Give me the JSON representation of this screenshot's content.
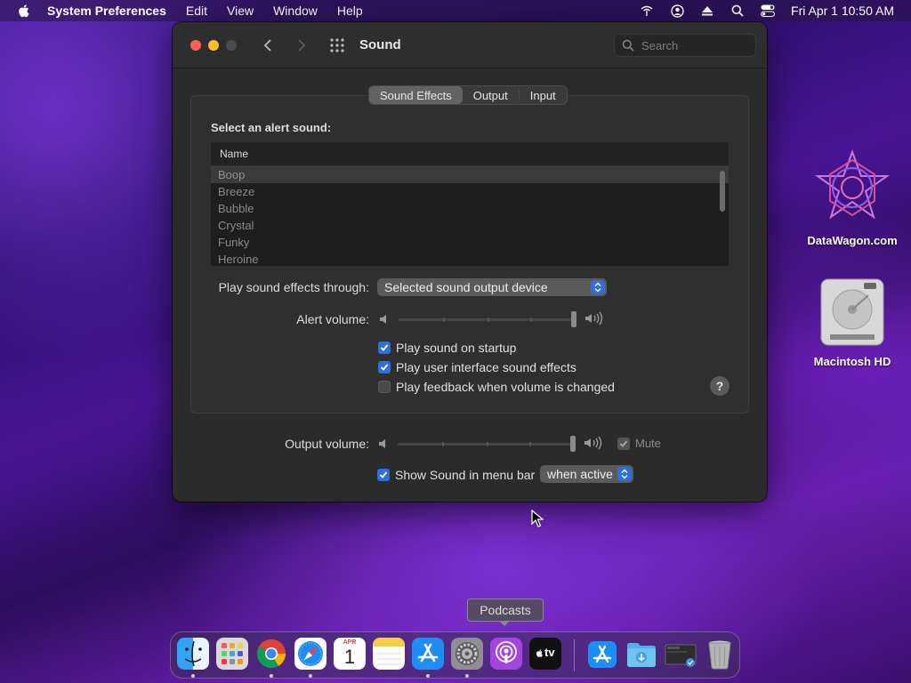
{
  "menubar": {
    "app_name": "System Preferences",
    "menus": [
      "Edit",
      "View",
      "Window",
      "Help"
    ],
    "clock": "Fri Apr 1  10:50 AM"
  },
  "window": {
    "title": "Sound",
    "search_placeholder": "Search",
    "tabs": [
      {
        "label": "Sound Effects",
        "active": true
      },
      {
        "label": "Output",
        "active": false
      },
      {
        "label": "Input",
        "active": false
      }
    ],
    "alert_label": "Select an alert sound:",
    "list": {
      "header": "Name",
      "items": [
        "Boop",
        "Breeze",
        "Bubble",
        "Crystal",
        "Funky",
        "Heroine"
      ],
      "selected": "Boop"
    },
    "play_through_label": "Play sound effects through:",
    "play_through_value": "Selected sound output device",
    "alert_volume_label": "Alert volume:",
    "alert_volume_level": 1.0,
    "checks": [
      {
        "label": "Play sound on startup",
        "checked": true
      },
      {
        "label": "Play user interface sound effects",
        "checked": true
      },
      {
        "label": "Play feedback when volume is changed",
        "checked": false
      }
    ],
    "help_label": "?",
    "output_volume_label": "Output volume:",
    "output_volume_level": 1.0,
    "mute_label": "Mute",
    "mute_checked": true,
    "show_menubar_label": "Show Sound in menu bar",
    "show_menubar_checked": true,
    "show_menubar_when": "when active"
  },
  "desktop": {
    "icons": [
      {
        "label": "DataWagon.com"
      },
      {
        "label": "Macintosh HD"
      }
    ]
  },
  "tooltip": "Podcasts",
  "calendar": {
    "month": "APR",
    "day": "1"
  },
  "appletv_label": "tv",
  "colors": {
    "accent": "#2f6fd8",
    "window_bg": "#2b2b2b"
  }
}
